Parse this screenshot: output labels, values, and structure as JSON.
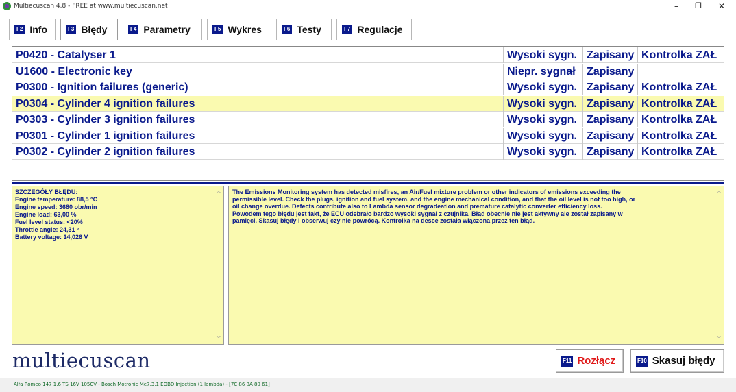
{
  "window": {
    "title": "Multiecuscan 4.8 - FREE at www.multiecuscan.net",
    "minimize_glyph": "–",
    "restore_glyph": "❐",
    "close_glyph": "✕"
  },
  "tabs": [
    {
      "key": "F2",
      "label": "Info",
      "active": false
    },
    {
      "key": "F3",
      "label": "Błędy",
      "active": true
    },
    {
      "key": "F4",
      "label": "Parametry",
      "active": false
    },
    {
      "key": "F5",
      "label": "Wykres",
      "active": false
    },
    {
      "key": "F6",
      "label": "Testy",
      "active": false
    },
    {
      "key": "F7",
      "label": "Regulacje",
      "active": false
    }
  ],
  "dtc_list": [
    {
      "description": "P0420 - Catalyser 1",
      "signal": "Wysoki sygn.",
      "status": "Zapisany",
      "mil": "Kontrolka ZAŁ",
      "selected": false
    },
    {
      "description": "U1600 - Electronic key",
      "signal": "Niepr. sygnał",
      "status": "Zapisany",
      "mil": "",
      "selected": false
    },
    {
      "description": "P0300 - Ignition failures (generic)",
      "signal": "Wysoki sygn.",
      "status": "Zapisany",
      "mil": "Kontrolka ZAŁ",
      "selected": false
    },
    {
      "description": "P0304 - Cylinder 4 ignition failures",
      "signal": "Wysoki sygn.",
      "status": "Zapisany",
      "mil": "Kontrolka ZAŁ",
      "selected": true
    },
    {
      "description": "P0303 - Cylinder 3 ignition failures",
      "signal": "Wysoki sygn.",
      "status": "Zapisany",
      "mil": "Kontrolka ZAŁ",
      "selected": false
    },
    {
      "description": "P0301 - Cylinder 1 ignition failures",
      "signal": "Wysoki sygn.",
      "status": "Zapisany",
      "mil": "Kontrolka ZAŁ",
      "selected": false
    },
    {
      "description": "P0302 - Cylinder 2 ignition failures",
      "signal": "Wysoki sygn.",
      "status": "Zapisany",
      "mil": "Kontrolka ZAŁ",
      "selected": false
    }
  ],
  "details": {
    "header": "SZCZEGÓŁY BŁĘDU:",
    "lines": [
      "Engine temperature: 88,5 °C",
      "Engine speed: 3680 obr/min",
      "Engine load: 63,00 %",
      "Fuel level status: <20%",
      "Throttle angle: 24,31 °",
      "Battery voltage: 14,026 V"
    ]
  },
  "description": {
    "line1": "The Emissions Monitoring system has detected misfires, an Air/Fuel mixture problem or other indicators of emissions exceeding the",
    "line2": "permissible level. Check the plugs, ignition and fuel system, and the engine mechanical condition, and that the oil level is not too high, or",
    "line3": "oil change overdue. Defects contribute also to Lambda sensor degradeation and premature catalytic converter efficiency loss.",
    "line4": "Powodem tego błędu jest fakt, że ECU odebrało bardzo wysoki sygnał z czujnika. Błąd obecnie nie jest aktywny ale został zapisany w",
    "line5": "pamięci. Skasuj błędy i obserwuj czy nie powrócą. Kontrolka na desce została włączona przez ten błąd."
  },
  "logo": "multiecuscan",
  "buttons": {
    "disconnect": {
      "key": "F11",
      "label": "Rozłącz"
    },
    "clear": {
      "key": "F10",
      "label": "Skasuj błędy"
    }
  },
  "statusbar": "Alfa Romeo 147 1.6 TS 16V 105CV - Bosch Motronic Me7.3.1 EOBD Injection (1 lambda) - [7C 86 8A 80 61]",
  "colors": {
    "accent": "#0a1a8c",
    "selected_row": "#fafab0",
    "disconnect_text": "#e01a1a",
    "status_text": "#116a28"
  },
  "icons": {
    "app": "multiecuscan-app-icon",
    "scroll_up": "scroll-up-arrow-icon",
    "scroll_down": "scroll-down-arrow-icon"
  }
}
